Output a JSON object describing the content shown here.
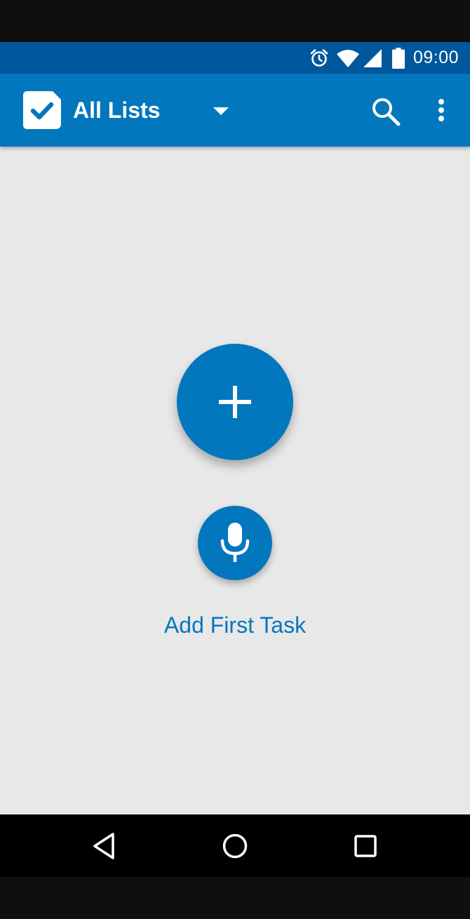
{
  "status_bar": {
    "time": "09:00",
    "icons": [
      "alarm-icon",
      "wifi-icon",
      "signal-icon",
      "battery-icon"
    ],
    "background": "#01579b"
  },
  "app_bar": {
    "title": "All Lists",
    "logo_icon": "checkbox-logo-icon",
    "actions": [
      "search-icon",
      "more-vert-icon"
    ],
    "background": "#0277bd"
  },
  "main": {
    "add_button_icon": "plus-icon",
    "voice_button_icon": "microphone-icon",
    "add_first_task_label": "Add First Task",
    "background": "#e8e8e8",
    "accent": "#0277bd"
  },
  "nav_bar": {
    "buttons": [
      "back-triangle-icon",
      "home-circle-icon",
      "recents-square-icon"
    ]
  }
}
